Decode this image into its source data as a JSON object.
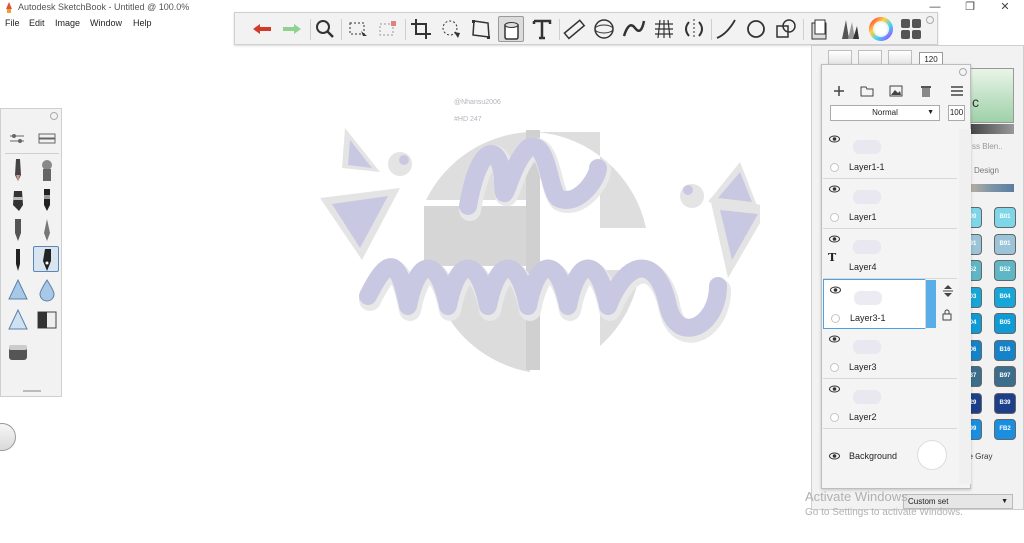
{
  "window": {
    "title": "Autodesk SketchBook - Untitled @ 100.0%"
  },
  "menu": [
    "File",
    "Edit",
    "Image",
    "Window",
    "Help"
  ],
  "toolbar": {
    "icons": [
      "undo-icon",
      "redo-icon",
      "zoom-icon",
      "select-icon",
      "transform-select-icon",
      "crop-icon",
      "lasso-icon",
      "distort-icon",
      "fill-icon",
      "text-icon",
      "ruler-icon",
      "ellipse-guide-icon",
      "french-curve-icon",
      "perspective-icon",
      "symmetry-icon",
      "stroke-icon",
      "circle-shape-icon",
      "shapes-icon",
      "copic-library-icon",
      "brush-library-icon",
      "color-wheel-icon",
      "layers-toggle-icon"
    ]
  },
  "canvas": {
    "credit": "@Nhansu2006",
    "tag": "#HD 247"
  },
  "layers": {
    "blend_mode": "Normal",
    "opacity": "100",
    "items": [
      {
        "name": "Layer1-1"
      },
      {
        "name": "Layer1"
      },
      {
        "name": "Layer4",
        "type": "text"
      },
      {
        "name": "Layer3-1",
        "selected": true
      },
      {
        "name": "Layer3"
      },
      {
        "name": "Layer2"
      }
    ],
    "background_label": "Background",
    "text_glyph": "T"
  },
  "copic": {
    "brush_size": "120",
    "partial_labels": [
      "c",
      "ss Blen..",
      "Design",
      "ne Gray"
    ],
    "swatches": [
      {
        "code": "B01",
        "color": "#7fd6e8"
      },
      {
        "code": "B91",
        "color": "#9cc4d8"
      },
      {
        "code": "B52",
        "color": "#5fb7c6"
      },
      {
        "code": "B04",
        "color": "#17a6d8"
      },
      {
        "code": "B05",
        "color": "#0f9bd6"
      },
      {
        "code": "B16",
        "color": "#1583c8"
      },
      {
        "code": "B97",
        "color": "#3c6e8c"
      },
      {
        "code": "B39",
        "color": "#1d3f8a"
      },
      {
        "code": "FB2",
        "color": "#1a8fe0"
      }
    ],
    "partial_swatch_codes": [
      "00",
      "91",
      "52",
      "03",
      "04",
      "06",
      "37",
      "29",
      "99"
    ],
    "custom_set": "Custom set"
  },
  "watermark": {
    "line1": "Activate Windows",
    "line2": "Go to Settings to activate Windows."
  },
  "colors": {
    "selection_blue": "#4aa3e6",
    "art_lavender": "#c9c8e3",
    "art_gray": "#dcdcdc",
    "undo_red": "#d43a2a",
    "redo_green": "#8fd28f"
  }
}
